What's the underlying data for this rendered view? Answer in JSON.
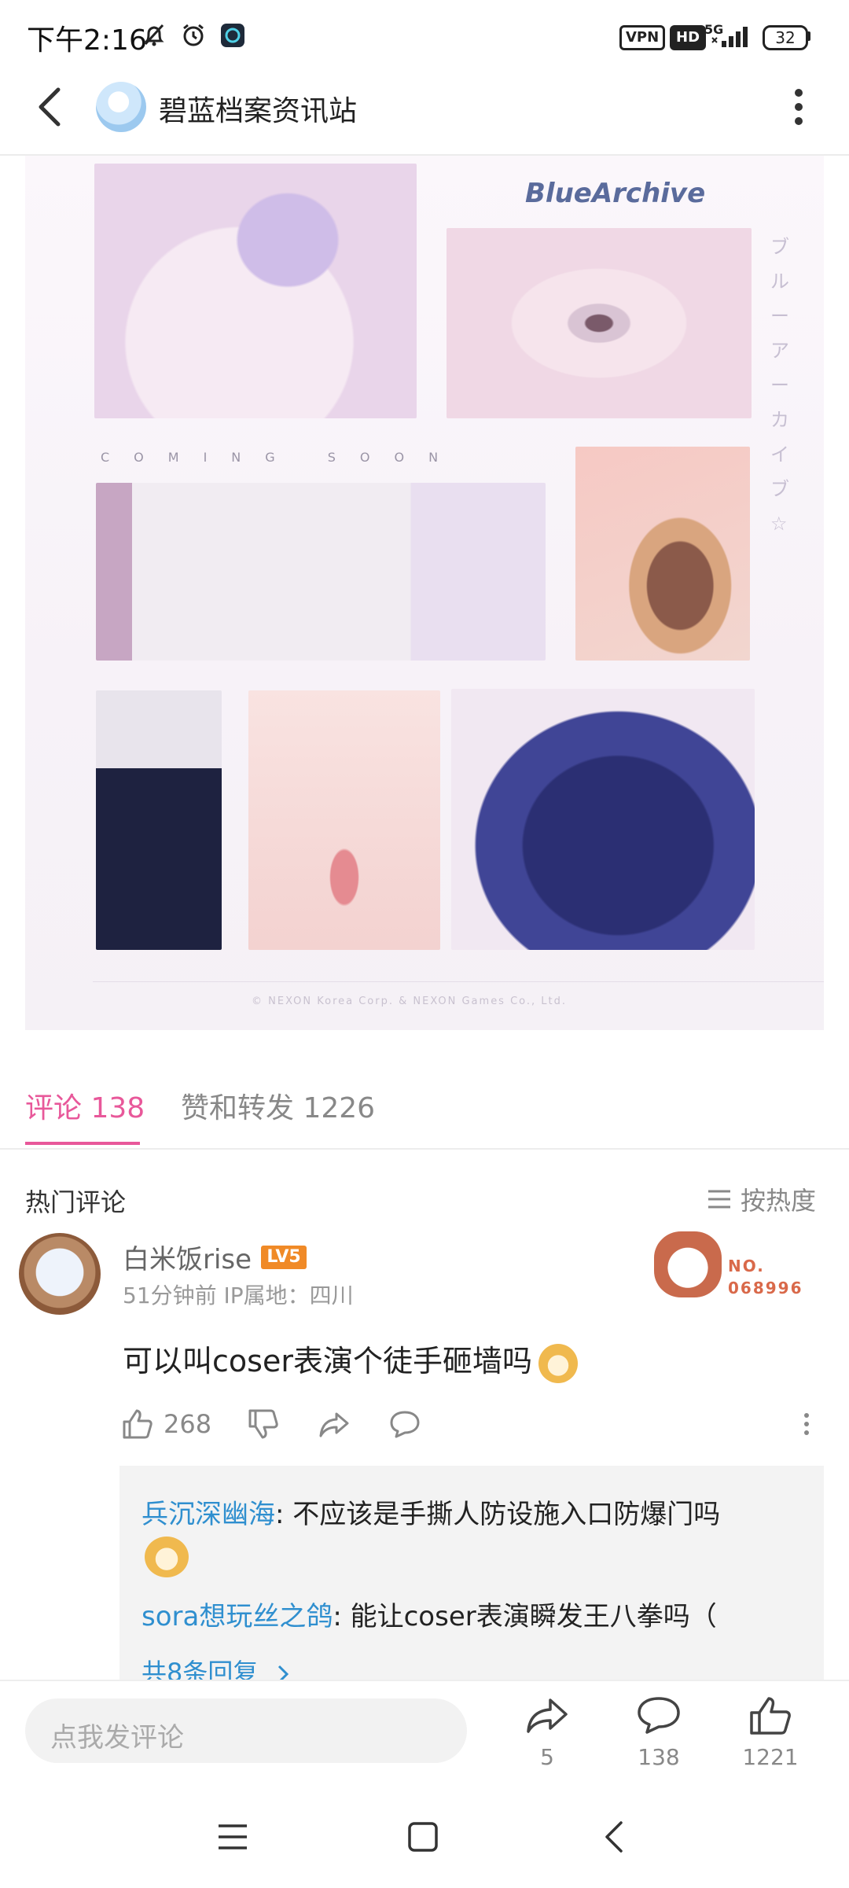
{
  "status_bar": {
    "time": "下午2:16",
    "vpn": "VPN",
    "hd": "HD",
    "network": "5G",
    "battery": "32"
  },
  "header": {
    "title": "碧蓝档案资讯站"
  },
  "hero": {
    "brand": "BlueArchive",
    "coming_soon": "COMING SOON",
    "vertical_text": "ブルーアーカイブ☆",
    "copyright": "© NEXON Korea Corp. & NEXON Games Co., Ltd."
  },
  "tabs": [
    {
      "label": "评论 138",
      "active": true
    },
    {
      "label": "赞和转发 1226",
      "active": false
    }
  ],
  "comments_header": {
    "hot_label": "热门评论",
    "sort_label": "按热度"
  },
  "comment": {
    "user": "白米饭rise",
    "level": "LV5",
    "meta": "51分钟前  IP属地：四川",
    "badge_no": "NO.",
    "badge_num": "068996",
    "text": "可以叫coser表演个徒手砸墙吗",
    "likes": "268",
    "replies": [
      {
        "name": "兵沉深幽海",
        "text": ": 不应该是手撕人防设施入口防爆门吗"
      },
      {
        "name": "sora想玩丝之鸽",
        "text": ": 能让coser表演瞬发王八拳吗（"
      }
    ],
    "more_replies": "共8条回复"
  },
  "bottom_bar": {
    "placeholder": "点我发评论",
    "share_count": "5",
    "comment_count": "138",
    "like_count": "1221"
  },
  "colors": {
    "accent": "#e8589a",
    "link": "#2f8fcf",
    "level_badge": "#f08a27"
  }
}
